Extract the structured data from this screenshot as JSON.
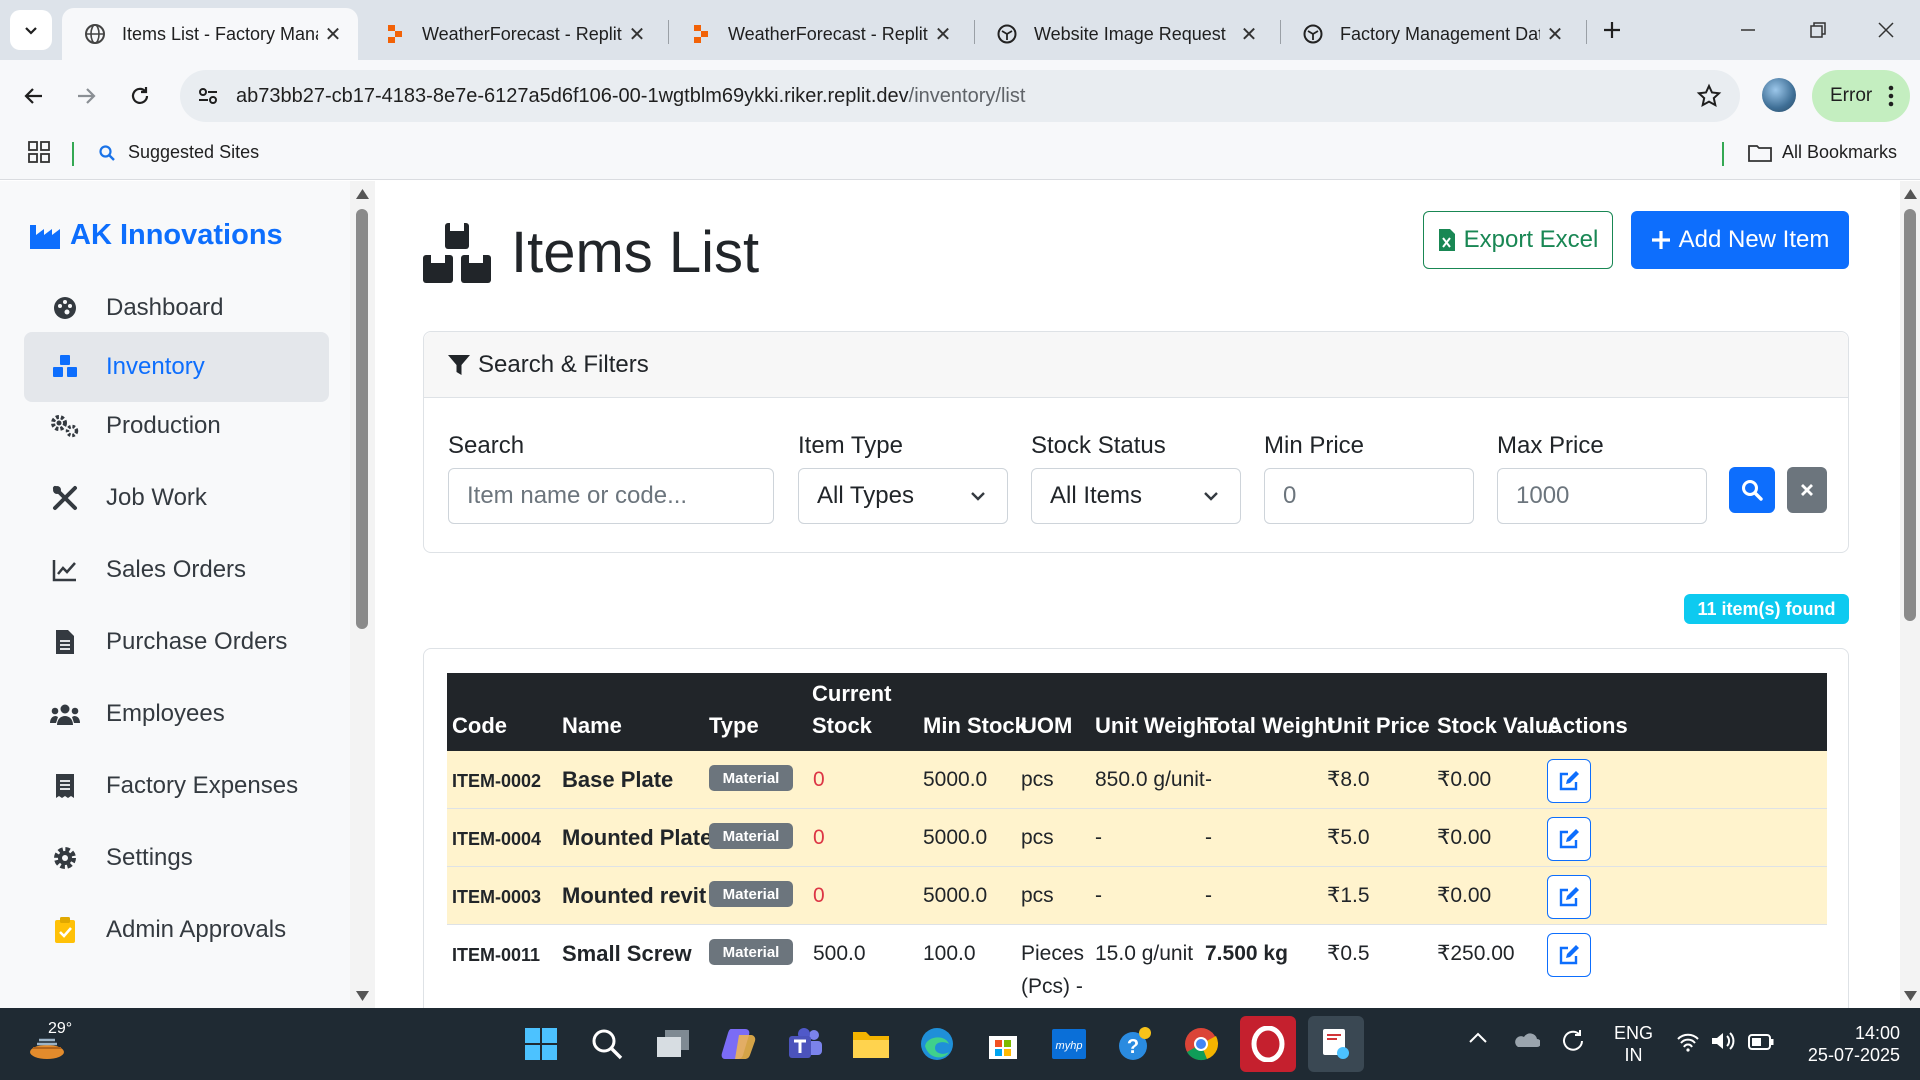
{
  "browser": {
    "tabs": [
      {
        "title": "Items List - Factory Mana",
        "active": true,
        "favicon": "globe-icon"
      },
      {
        "title": "WeatherForecast - Replit",
        "active": false,
        "favicon": "replit-icon"
      },
      {
        "title": "WeatherForecast - Replit",
        "active": false,
        "favicon": "replit-icon"
      },
      {
        "title": "Website Image Request",
        "active": false,
        "favicon": "chatgpt-icon"
      },
      {
        "title": "Factory Management Dat",
        "active": false,
        "favicon": "chatgpt-icon"
      }
    ],
    "url_host": "ab73bb27-cb17-4183-8e7e-6127a5d6f106-00-1wgtblm69ykki.riker.replit.dev",
    "url_path": "/inventory/list",
    "profile_status": "Error",
    "bookmarks": {
      "suggested": "Suggested Sites",
      "all": "All Bookmarks"
    }
  },
  "sidebar": {
    "brand": "AK Innovations",
    "items": [
      {
        "label": "Dashboard",
        "icon": "palette-icon",
        "active": false
      },
      {
        "label": "Inventory",
        "icon": "boxes-icon",
        "active": true
      },
      {
        "label": "Production",
        "icon": "cogs-icon",
        "active": false
      },
      {
        "label": "Job Work",
        "icon": "tools-icon",
        "active": false
      },
      {
        "label": "Sales Orders",
        "icon": "chart-line-icon",
        "active": false
      },
      {
        "label": "Purchase Orders",
        "icon": "file-invoice-icon",
        "active": false
      },
      {
        "label": "Employees",
        "icon": "users-icon",
        "active": false
      },
      {
        "label": "Factory Expenses",
        "icon": "receipt-icon",
        "active": false
      },
      {
        "label": "Settings",
        "icon": "gear-icon",
        "active": false
      },
      {
        "label": "Admin Approvals",
        "icon": "clipboard-check-icon",
        "active": false
      }
    ]
  },
  "page": {
    "title": "Items List",
    "export_label": "Export Excel",
    "add_label": "Add New Item"
  },
  "filters": {
    "header": "Search & Filters",
    "search_label": "Search",
    "search_placeholder": "Item name or code...",
    "type_label": "Item Type",
    "type_value": "All Types",
    "status_label": "Stock Status",
    "status_value": "All Items",
    "min_label": "Min Price",
    "min_value": "0",
    "max_label": "Max Price",
    "max_value": "1000"
  },
  "result_count": "11 item(s) found",
  "table": {
    "headers": {
      "code": "Code",
      "name": "Name",
      "type": "Type",
      "current_stock_1": "Current",
      "current_stock_2": "Stock",
      "min_stock": "Min Stock",
      "uom": "UOM",
      "unit_weight": "Unit Weight",
      "total_weight": "Total Weight",
      "unit_price": "Unit Price",
      "stock_value": "Stock Value",
      "actions": "Actions"
    },
    "rows": [
      {
        "code": "ITEM-0002",
        "name": "Base Plate",
        "type": "Material",
        "current_stock": "0",
        "min_stock": "5000.0",
        "uom": "pcs",
        "uom2": "",
        "unit_weight": "850.0 g/unit",
        "total_weight": "-",
        "unit_price": "₹8.0",
        "stock_value": "₹0.00",
        "low": true
      },
      {
        "code": "ITEM-0004",
        "name": "Mounted Plate",
        "type": "Material",
        "current_stock": "0",
        "min_stock": "5000.0",
        "uom": "pcs",
        "uom2": "",
        "unit_weight": "-",
        "total_weight": "-",
        "unit_price": "₹5.0",
        "stock_value": "₹0.00",
        "low": true
      },
      {
        "code": "ITEM-0003",
        "name": "Mounted revit",
        "type": "Material",
        "current_stock": "0",
        "min_stock": "5000.0",
        "uom": "pcs",
        "uom2": "",
        "unit_weight": "-",
        "total_weight": "-",
        "unit_price": "₹1.5",
        "stock_value": "₹0.00",
        "low": true
      },
      {
        "code": "ITEM-0011",
        "name": "Small Screw",
        "type": "Material",
        "current_stock": "500.0",
        "min_stock": "100.0",
        "uom": "Pieces",
        "uom2": "(Pcs) -",
        "unit_weight": "15.0 g/unit",
        "total_weight": "7.500 kg",
        "unit_price": "₹0.5",
        "stock_value": "₹250.00",
        "low": false
      }
    ]
  },
  "taskbar": {
    "weather_temp": "29°",
    "lang_1": "ENG",
    "lang_2": "IN",
    "time": "14:00",
    "date": "25-07-2025"
  },
  "colors": {
    "primary": "#0d6efd",
    "success": "#198754",
    "secondary": "#6c757d",
    "info": "#0dcaf0",
    "danger": "#dc3545",
    "warning_row": "#fff3cd",
    "table_head": "#212529"
  }
}
